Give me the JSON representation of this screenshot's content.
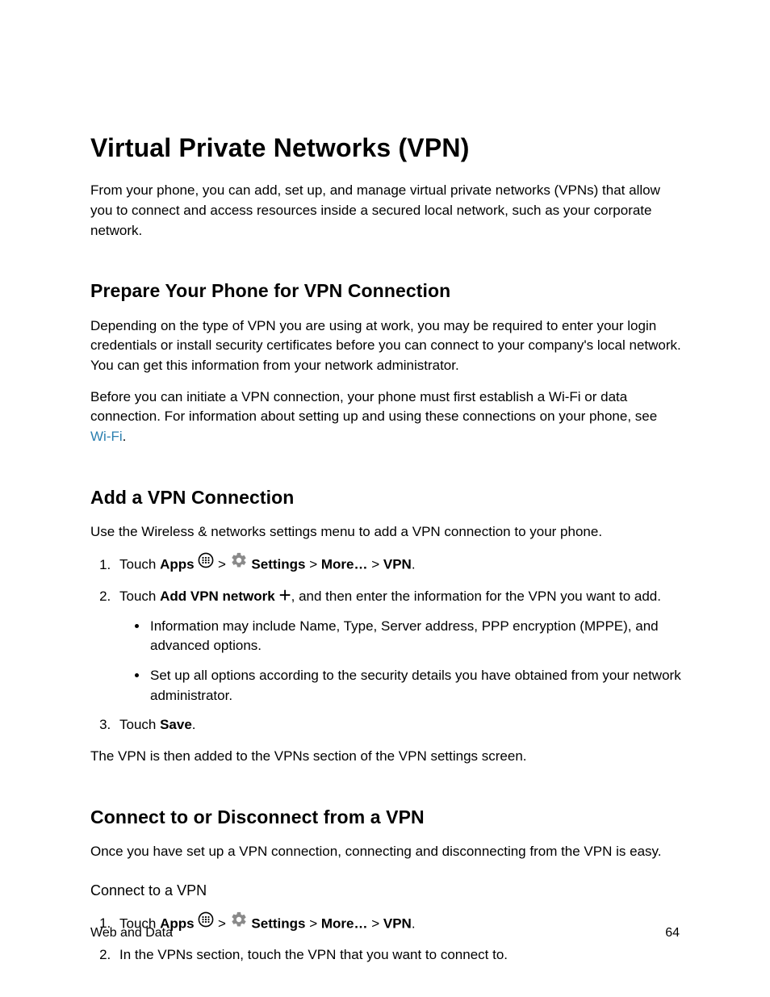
{
  "h1": "Virtual Private Networks (VPN)",
  "intro": "From your phone, you can add, set up, and manage virtual private networks (VPNs) that allow you to connect and access resources inside a secured local network, such as your corporate network.",
  "s1_h": "Prepare Your Phone for VPN Connection",
  "s1_p1": "Depending on the type of VPN you are using at work, you may be required to enter your login credentials or install security certificates before you can connect to your company's local network. You can get this information from your network administrator.",
  "s1_p2a": "Before you can initiate a VPN connection, your phone must first establish a Wi-Fi or data connection. For information about setting up and using these connections on your phone, see ",
  "s1_link": "Wi-Fi",
  "s1_p2b": ".",
  "s2_h": "Add a VPN Connection",
  "s2_p1": "Use the Wireless & networks settings menu to add a VPN connection to your phone.",
  "s2_li1_touch": "Touch ",
  "s2_li1_apps": "Apps",
  "s2_li1_gt1": " > ",
  "s2_li1_settings": " Settings",
  "s2_li1_gt2": " > ",
  "s2_li1_more": "More…",
  "s2_li1_gt3": " > ",
  "s2_li1_vpn": "VPN",
  "s2_li1_end": ".",
  "s2_li2_a": "Touch ",
  "s2_li2_add": "Add VPN network ",
  "s2_li2_b": ", and then enter the information for the VPN you want to add.",
  "s2_li2_sub1": "Information may include Name, Type, Server address, PPP encryption (MPPE), and advanced options.",
  "s2_li2_sub2": "Set up all options according to the security details you have obtained from your network administrator.",
  "s2_li3_a": "Touch ",
  "s2_li3_save": "Save",
  "s2_li3_b": ".",
  "s2_p2": "The VPN is then added to the VPNs section of the VPN settings screen.",
  "s3_h": "Connect to or Disconnect from a VPN",
  "s3_p1": "Once you have set up a VPN connection, connecting and disconnecting from the VPN is easy.",
  "s3_sub_h": "Connect to a VPN",
  "s3_li1_touch": "Touch ",
  "s3_li1_apps": "Apps",
  "s3_li1_gt1": " > ",
  "s3_li1_settings": " Settings",
  "s3_li1_gt2": " > ",
  "s3_li1_more": "More…",
  "s3_li1_gt3": " > ",
  "s3_li1_vpn": "VPN",
  "s3_li1_end": ".",
  "s3_li2": "In the VPNs section, touch the VPN that you want to connect to.",
  "footer_left": "Web and Data",
  "footer_right": "64"
}
